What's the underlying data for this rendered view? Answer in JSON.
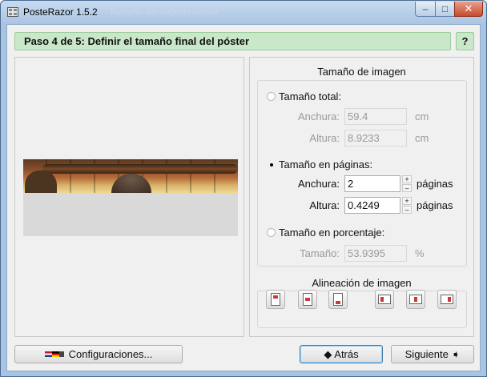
{
  "window": {
    "title": "PosteRazor 1.5.2",
    "ghost_title": "Tamaño de superposición",
    "minimize": "–",
    "maximize": "□",
    "close": "✕"
  },
  "step": {
    "title": "Paso 4 de 5: Definir el tamaño final del póster",
    "help": "?"
  },
  "image_size": {
    "title": "Tamaño de imagen",
    "total": {
      "label": "Tamaño total:",
      "width_label": "Anchura:",
      "width_value": "59.4",
      "width_unit": "cm",
      "height_label": "Altura:",
      "height_value": "8.9233",
      "height_unit": "cm"
    },
    "pages": {
      "label": "Tamaño en páginas:",
      "width_label": "Anchura:",
      "width_value": "2",
      "width_unit": "páginas",
      "height_label": "Altura:",
      "height_value": "0.4249",
      "height_unit": "páginas"
    },
    "percent": {
      "label": "Tamaño en porcentaje:",
      "size_label": "Tamaño:",
      "size_value": "53.9395",
      "size_unit": "%"
    },
    "selected": "pages"
  },
  "alignment": {
    "title": "Alineación de imagen"
  },
  "buttons": {
    "settings": "Configuraciones...",
    "back": "◆ Atrás",
    "next": "Siguiente ➧"
  },
  "icons": {
    "spin_up": "+",
    "spin_down": "–"
  },
  "colors": {
    "step_bar": "#c9e7c9",
    "window_frame": "#a9c4e2",
    "close_button": "#c84a2e"
  }
}
